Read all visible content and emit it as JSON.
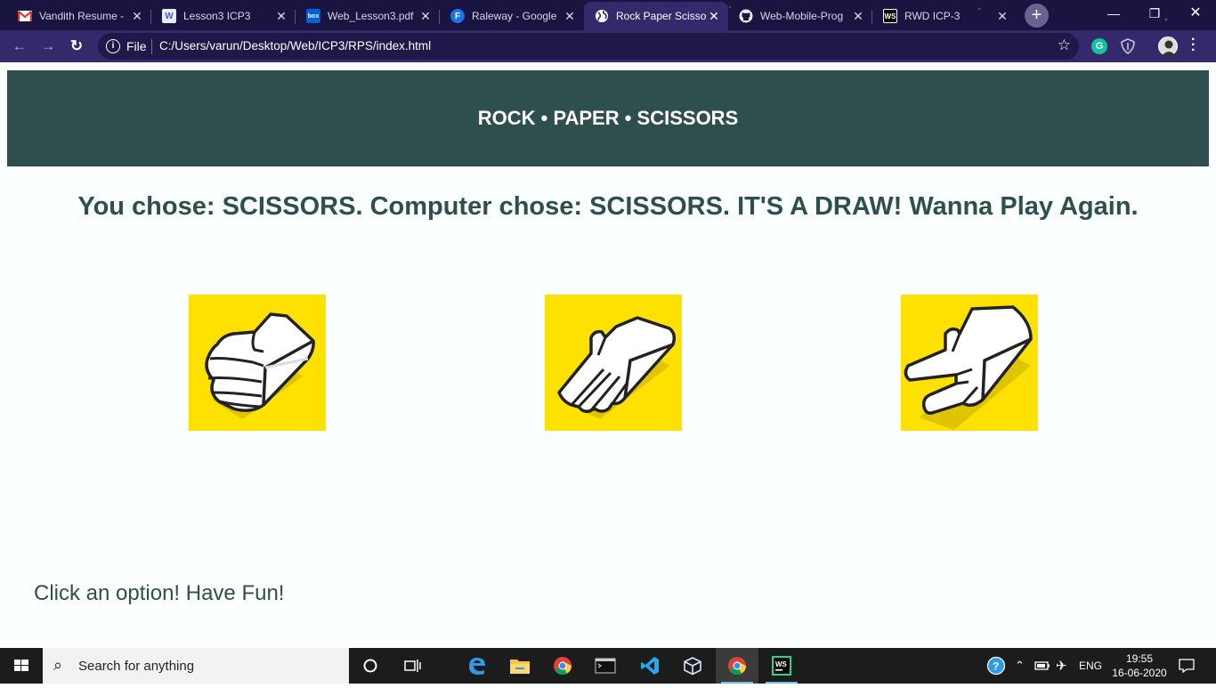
{
  "browser": {
    "tabs": [
      {
        "title": "Vandith Resume -",
        "favicon": "gmail-icon"
      },
      {
        "title": "Lesson3 ICP3",
        "favicon": "document-icon"
      },
      {
        "title": "Web_Lesson3.pdf",
        "favicon": "box-icon"
      },
      {
        "title": "Raleway - Google",
        "favicon": "google-fonts-icon"
      },
      {
        "title": "Rock Paper Scissor",
        "favicon": "globe-icon",
        "active": true
      },
      {
        "title": "Web-Mobile-Prog",
        "favicon": "github-icon"
      },
      {
        "title": "RWD ICP-3",
        "favicon": "webstorm-icon"
      }
    ],
    "address": {
      "scheme_label": "File",
      "url": "C:/Users/varun/Desktop/Web/ICP3/RPS/index.html"
    }
  },
  "page": {
    "header_title": "ROCK • PAPER • SCISSORS",
    "result_text": "You chose: SCISSORS. Computer chose: SCISSORS. IT'S A DRAW! Wanna Play Again.",
    "choices": [
      {
        "name": "rock",
        "icon": "rock-hand-icon"
      },
      {
        "name": "paper",
        "icon": "paper-hand-icon"
      },
      {
        "name": "scissors",
        "icon": "scissors-hand-icon"
      }
    ],
    "hint": "Click an option! Have Fun!",
    "colors": {
      "header_bg": "#2f4f4f",
      "text": "#2f4f4f",
      "choice_bg": "#ffe100",
      "page_bg": "#fbfffd"
    }
  },
  "taskbar": {
    "search_placeholder": "Search for anything",
    "language": "ENG",
    "time": "19:55",
    "date": "16-06-2020"
  }
}
